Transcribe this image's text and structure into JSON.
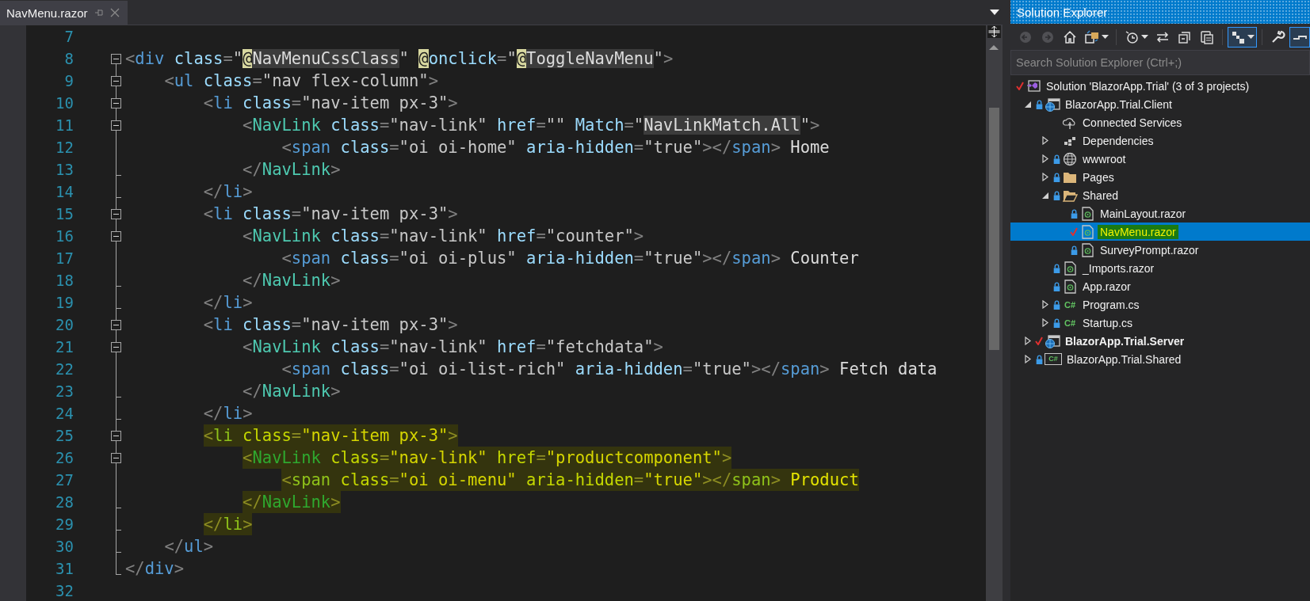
{
  "editor": {
    "tab": {
      "label": "NavMenu.razor",
      "selected": true
    },
    "lines": [
      {
        "number": "7",
        "kind": "plain",
        "highlighted": false
      },
      {
        "number": "8",
        "kind": "fold-start",
        "highlighted": false,
        "tokens": [
          {
            "kind": "punct",
            "text": "<"
          },
          {
            "kind": "tag",
            "text": "div"
          },
          {
            "kind": "attr",
            "text": " class"
          },
          {
            "kind": "punct",
            "text": "="
          },
          {
            "kind": "str",
            "text": "\""
          },
          {
            "kind": "at",
            "text": "@"
          },
          {
            "kind": "expr",
            "text": "NavMenuCssClass"
          },
          {
            "kind": "str",
            "text": "\" "
          },
          {
            "kind": "at",
            "text": "@"
          },
          {
            "kind": "directive",
            "text": "onclick"
          },
          {
            "kind": "punct",
            "text": "="
          },
          {
            "kind": "str",
            "text": "\""
          },
          {
            "kind": "at",
            "text": "@"
          },
          {
            "kind": "expr",
            "text": "ToggleNavMenu"
          },
          {
            "kind": "str",
            "text": "\""
          },
          {
            "kind": "punct",
            "text": ">"
          }
        ]
      },
      {
        "number": "9",
        "kind": "fold-start",
        "highlighted": false,
        "tokens": [
          {
            "kind": "punct",
            "text": "    <"
          },
          {
            "kind": "tag",
            "text": "ul"
          },
          {
            "kind": "attr",
            "text": " class"
          },
          {
            "kind": "punct",
            "text": "="
          },
          {
            "kind": "str",
            "text": "\"nav flex-column\""
          },
          {
            "kind": "punct",
            "text": ">"
          }
        ]
      },
      {
        "number": "10",
        "kind": "fold-start",
        "highlighted": false,
        "tokens": [
          {
            "kind": "punct",
            "text": "        <"
          },
          {
            "kind": "tag",
            "text": "li"
          },
          {
            "kind": "attr",
            "text": " class"
          },
          {
            "kind": "punct",
            "text": "="
          },
          {
            "kind": "str",
            "text": "\"nav-item px-3\""
          },
          {
            "kind": "punct",
            "text": ">"
          }
        ]
      },
      {
        "number": "11",
        "kind": "fold-start",
        "highlighted": false,
        "tokens": [
          {
            "kind": "punct",
            "text": "            <"
          },
          {
            "kind": "comp",
            "text": "NavLink"
          },
          {
            "kind": "attr",
            "text": " class"
          },
          {
            "kind": "punct",
            "text": "="
          },
          {
            "kind": "str",
            "text": "\"nav-link\""
          },
          {
            "kind": "attr",
            "text": " href"
          },
          {
            "kind": "punct",
            "text": "="
          },
          {
            "kind": "str",
            "text": "\"\""
          },
          {
            "kind": "attr",
            "text": " Match"
          },
          {
            "kind": "punct",
            "text": "="
          },
          {
            "kind": "str",
            "text": "\""
          },
          {
            "kind": "expr",
            "text": "NavLinkMatch.All"
          },
          {
            "kind": "str",
            "text": "\""
          },
          {
            "kind": "punct",
            "text": ">"
          }
        ]
      },
      {
        "number": "12",
        "kind": "fold-inner",
        "highlighted": false,
        "tokens": [
          {
            "kind": "punct",
            "text": "                <"
          },
          {
            "kind": "tag",
            "text": "span"
          },
          {
            "kind": "attr",
            "text": " class"
          },
          {
            "kind": "punct",
            "text": "="
          },
          {
            "kind": "str",
            "text": "\"oi oi-home\""
          },
          {
            "kind": "attr",
            "text": " aria-hidden"
          },
          {
            "kind": "punct",
            "text": "="
          },
          {
            "kind": "str",
            "text": "\"true\""
          },
          {
            "kind": "punct",
            "text": "></"
          },
          {
            "kind": "tag",
            "text": "span"
          },
          {
            "kind": "punct",
            "text": ">"
          },
          {
            "kind": "text",
            "text": " Home"
          }
        ]
      },
      {
        "number": "13",
        "kind": "fold-end",
        "highlighted": false,
        "tokens": [
          {
            "kind": "punct",
            "text": "            </"
          },
          {
            "kind": "comp",
            "text": "NavLink"
          },
          {
            "kind": "punct",
            "text": ">"
          }
        ]
      },
      {
        "number": "14",
        "kind": "fold-end",
        "highlighted": false,
        "tokens": [
          {
            "kind": "punct",
            "text": "        </"
          },
          {
            "kind": "tag",
            "text": "li"
          },
          {
            "kind": "punct",
            "text": ">"
          }
        ]
      },
      {
        "number": "15",
        "kind": "fold-start",
        "highlighted": false,
        "tokens": [
          {
            "kind": "punct",
            "text": "        <"
          },
          {
            "kind": "tag",
            "text": "li"
          },
          {
            "kind": "attr",
            "text": " class"
          },
          {
            "kind": "punct",
            "text": "="
          },
          {
            "kind": "str",
            "text": "\"nav-item px-3\""
          },
          {
            "kind": "punct",
            "text": ">"
          }
        ]
      },
      {
        "number": "16",
        "kind": "fold-start",
        "highlighted": false,
        "tokens": [
          {
            "kind": "punct",
            "text": "            <"
          },
          {
            "kind": "comp",
            "text": "NavLink"
          },
          {
            "kind": "attr",
            "text": " class"
          },
          {
            "kind": "punct",
            "text": "="
          },
          {
            "kind": "str",
            "text": "\"nav-link\""
          },
          {
            "kind": "attr",
            "text": " href"
          },
          {
            "kind": "punct",
            "text": "="
          },
          {
            "kind": "str",
            "text": "\"counter\""
          },
          {
            "kind": "punct",
            "text": ">"
          }
        ]
      },
      {
        "number": "17",
        "kind": "fold-inner",
        "highlighted": false,
        "tokens": [
          {
            "kind": "punct",
            "text": "                <"
          },
          {
            "kind": "tag",
            "text": "span"
          },
          {
            "kind": "attr",
            "text": " class"
          },
          {
            "kind": "punct",
            "text": "="
          },
          {
            "kind": "str",
            "text": "\"oi oi-plus\""
          },
          {
            "kind": "attr",
            "text": " aria-hidden"
          },
          {
            "kind": "punct",
            "text": "="
          },
          {
            "kind": "str",
            "text": "\"true\""
          },
          {
            "kind": "punct",
            "text": "></"
          },
          {
            "kind": "tag",
            "text": "span"
          },
          {
            "kind": "punct",
            "text": ">"
          },
          {
            "kind": "text",
            "text": " Counter"
          }
        ]
      },
      {
        "number": "18",
        "kind": "fold-end",
        "highlighted": false,
        "tokens": [
          {
            "kind": "punct",
            "text": "            </"
          },
          {
            "kind": "comp",
            "text": "NavLink"
          },
          {
            "kind": "punct",
            "text": ">"
          }
        ]
      },
      {
        "number": "19",
        "kind": "fold-end",
        "highlighted": false,
        "tokens": [
          {
            "kind": "punct",
            "text": "        </"
          },
          {
            "kind": "tag",
            "text": "li"
          },
          {
            "kind": "punct",
            "text": ">"
          }
        ]
      },
      {
        "number": "20",
        "kind": "fold-start",
        "highlighted": false,
        "tokens": [
          {
            "kind": "punct",
            "text": "        <"
          },
          {
            "kind": "tag",
            "text": "li"
          },
          {
            "kind": "attr",
            "text": " class"
          },
          {
            "kind": "punct",
            "text": "="
          },
          {
            "kind": "str",
            "text": "\"nav-item px-3\""
          },
          {
            "kind": "punct",
            "text": ">"
          }
        ]
      },
      {
        "number": "21",
        "kind": "fold-start",
        "highlighted": false,
        "tokens": [
          {
            "kind": "punct",
            "text": "            <"
          },
          {
            "kind": "comp",
            "text": "NavLink"
          },
          {
            "kind": "attr",
            "text": " class"
          },
          {
            "kind": "punct",
            "text": "="
          },
          {
            "kind": "str",
            "text": "\"nav-link\""
          },
          {
            "kind": "attr",
            "text": " href"
          },
          {
            "kind": "punct",
            "text": "="
          },
          {
            "kind": "str",
            "text": "\"fetchdata\""
          },
          {
            "kind": "punct",
            "text": ">"
          }
        ]
      },
      {
        "number": "22",
        "kind": "fold-inner",
        "highlighted": false,
        "tokens": [
          {
            "kind": "punct",
            "text": "                <"
          },
          {
            "kind": "tag",
            "text": "span"
          },
          {
            "kind": "attr",
            "text": " class"
          },
          {
            "kind": "punct",
            "text": "="
          },
          {
            "kind": "str",
            "text": "\"oi oi-list-rich\""
          },
          {
            "kind": "attr",
            "text": " aria-hidden"
          },
          {
            "kind": "punct",
            "text": "="
          },
          {
            "kind": "str",
            "text": "\"true\""
          },
          {
            "kind": "punct",
            "text": "></"
          },
          {
            "kind": "tag",
            "text": "span"
          },
          {
            "kind": "punct",
            "text": ">"
          },
          {
            "kind": "text",
            "text": " Fetch data"
          }
        ]
      },
      {
        "number": "23",
        "kind": "fold-end",
        "highlighted": false,
        "tokens": [
          {
            "kind": "punct",
            "text": "            </"
          },
          {
            "kind": "comp",
            "text": "NavLink"
          },
          {
            "kind": "punct",
            "text": ">"
          }
        ]
      },
      {
        "number": "24",
        "kind": "fold-end",
        "highlighted": false,
        "tokens": [
          {
            "kind": "punct",
            "text": "        </"
          },
          {
            "kind": "tag",
            "text": "li"
          },
          {
            "kind": "punct",
            "text": ">"
          }
        ]
      },
      {
        "number": "25",
        "kind": "fold-start",
        "highlighted": true,
        "tokens": [
          {
            "kind": "punct",
            "text": "        <"
          },
          {
            "kind": "tag",
            "text": "li"
          },
          {
            "kind": "attr",
            "text": " class"
          },
          {
            "kind": "punct",
            "text": "="
          },
          {
            "kind": "str",
            "text": "\"nav-item px-3\""
          },
          {
            "kind": "punct",
            "text": ">"
          }
        ]
      },
      {
        "number": "26",
        "kind": "fold-start",
        "highlighted": true,
        "tokens": [
          {
            "kind": "punct",
            "text": "            <"
          },
          {
            "kind": "comp",
            "text": "NavLink"
          },
          {
            "kind": "attr",
            "text": " class"
          },
          {
            "kind": "punct",
            "text": "="
          },
          {
            "kind": "str",
            "text": "\"nav-link\""
          },
          {
            "kind": "attr",
            "text": " href"
          },
          {
            "kind": "punct",
            "text": "="
          },
          {
            "kind": "str",
            "text": "\"productcomponent\""
          },
          {
            "kind": "punct",
            "text": ">"
          }
        ]
      },
      {
        "number": "27",
        "kind": "fold-inner",
        "highlighted": true,
        "tokens": [
          {
            "kind": "punct",
            "text": "                <"
          },
          {
            "kind": "tag",
            "text": "span"
          },
          {
            "kind": "attr",
            "text": " class"
          },
          {
            "kind": "punct",
            "text": "="
          },
          {
            "kind": "str",
            "text": "\"oi oi-menu\""
          },
          {
            "kind": "attr",
            "text": " aria-hidden"
          },
          {
            "kind": "punct",
            "text": "="
          },
          {
            "kind": "str",
            "text": "\"true\""
          },
          {
            "kind": "punct",
            "text": "></"
          },
          {
            "kind": "tag",
            "text": "span"
          },
          {
            "kind": "punct",
            "text": ">"
          },
          {
            "kind": "text",
            "text": " Product"
          }
        ]
      },
      {
        "number": "28",
        "kind": "fold-end",
        "highlighted": true,
        "tokens": [
          {
            "kind": "punct",
            "text": "            </"
          },
          {
            "kind": "comp",
            "text": "NavLink"
          },
          {
            "kind": "punct",
            "text": ">"
          }
        ]
      },
      {
        "number": "29",
        "kind": "fold-end",
        "highlighted": true,
        "tokens": [
          {
            "kind": "punct",
            "text": "        </"
          },
          {
            "kind": "tag",
            "text": "li"
          },
          {
            "kind": "punct",
            "text": ">"
          }
        ]
      },
      {
        "number": "30",
        "kind": "fold-end",
        "highlighted": false,
        "tokens": [
          {
            "kind": "punct",
            "text": "    </"
          },
          {
            "kind": "tag",
            "text": "ul"
          },
          {
            "kind": "punct",
            "text": ">"
          }
        ]
      },
      {
        "number": "31",
        "kind": "fold-end",
        "highlighted": false,
        "tokens": [
          {
            "kind": "punct",
            "text": "</"
          },
          {
            "kind": "tag",
            "text": "div"
          },
          {
            "kind": "punct",
            "text": ">"
          }
        ]
      },
      {
        "number": "32",
        "kind": "plain",
        "highlighted": false
      }
    ]
  },
  "solution_explorer": {
    "title": "Solution Explorer",
    "toolbar": [
      {
        "kind": "back",
        "disabled": true,
        "on": false,
        "dropdown": false
      },
      {
        "kind": "forward",
        "disabled": true,
        "on": false,
        "dropdown": false
      },
      {
        "kind": "home",
        "disabled": false,
        "on": false,
        "dropdown": false
      },
      {
        "kind": "switch-views",
        "disabled": false,
        "on": false,
        "dropdown": true
      },
      {
        "kind": "separator"
      },
      {
        "kind": "history",
        "disabled": false,
        "on": false,
        "dropdown": true
      },
      {
        "kind": "sync",
        "disabled": false,
        "on": false,
        "dropdown": false
      },
      {
        "kind": "collapse-all",
        "disabled": false,
        "on": false,
        "dropdown": false
      },
      {
        "kind": "copy",
        "disabled": false,
        "on": false,
        "dropdown": false
      },
      {
        "kind": "separator"
      },
      {
        "kind": "tree-view",
        "disabled": false,
        "on": true,
        "dropdown": true
      },
      {
        "kind": "separator"
      },
      {
        "kind": "properties",
        "disabled": false,
        "on": false,
        "dropdown": false
      },
      {
        "kind": "preview",
        "disabled": false,
        "on": true,
        "dropdown": false
      }
    ],
    "search": {
      "placeholder": "Search Solution Explorer (Ctrl+;)"
    },
    "solution": {
      "label": "Solution 'BlazorApp.Trial' (3 of 3 projects)",
      "kind": "solution",
      "checked": true,
      "selected": false,
      "bold": false,
      "children": [
        {
          "label": "BlazorApp.Trial.Client",
          "kind": "web-project",
          "expanded": true,
          "checked": false,
          "locked": true,
          "selected": false,
          "bold": false,
          "children": [
            {
              "label": "Connected Services",
              "kind": "connected-services",
              "checked": false,
              "locked": false,
              "selected": false,
              "bold": false
            },
            {
              "label": "Dependencies",
              "kind": "dependencies",
              "expanded": false,
              "checked": false,
              "locked": false,
              "selected": false,
              "bold": false
            },
            {
              "label": "wwwroot",
              "kind": "globe",
              "expanded": false,
              "checked": false,
              "locked": true,
              "selected": false,
              "bold": false
            },
            {
              "label": "Pages",
              "kind": "folder",
              "expanded": false,
              "checked": false,
              "locked": true,
              "selected": false,
              "bold": false
            },
            {
              "label": "Shared",
              "kind": "folder-open",
              "expanded": true,
              "checked": false,
              "locked": true,
              "selected": false,
              "bold": false,
              "children": [
                {
                  "label": "MainLayout.razor",
                  "kind": "razor",
                  "checked": false,
                  "locked": true,
                  "selected": false,
                  "bold": false
                },
                {
                  "label": "NavMenu.razor",
                  "kind": "razor",
                  "checked": true,
                  "selected": true,
                  "bold": false
                },
                {
                  "label": "SurveyPrompt.razor",
                  "kind": "razor",
                  "checked": false,
                  "locked": true,
                  "selected": false,
                  "bold": false
                }
              ]
            },
            {
              "label": "_Imports.razor",
              "kind": "razor",
              "checked": false,
              "locked": true,
              "selected": false,
              "bold": false
            },
            {
              "label": "App.razor",
              "kind": "razor",
              "checked": false,
              "locked": true,
              "selected": false,
              "bold": false
            },
            {
              "label": "Program.cs",
              "kind": "csharp",
              "badge": "C#",
              "expanded": false,
              "checked": false,
              "locked": true,
              "selected": false,
              "bold": false
            },
            {
              "label": "Startup.cs",
              "kind": "csharp",
              "badge": "C#",
              "expanded": false,
              "checked": false,
              "locked": true,
              "selected": false,
              "bold": false
            }
          ]
        },
        {
          "label": "BlazorApp.Trial.Server",
          "kind": "web-project",
          "expanded": false,
          "checked": true,
          "selected": false,
          "bold": true
        },
        {
          "label": "BlazorApp.Trial.Shared",
          "kind": "cs-project",
          "badge": "C#",
          "expanded": false,
          "checked": false,
          "locked": true,
          "selected": false,
          "bold": false
        }
      ]
    }
  }
}
